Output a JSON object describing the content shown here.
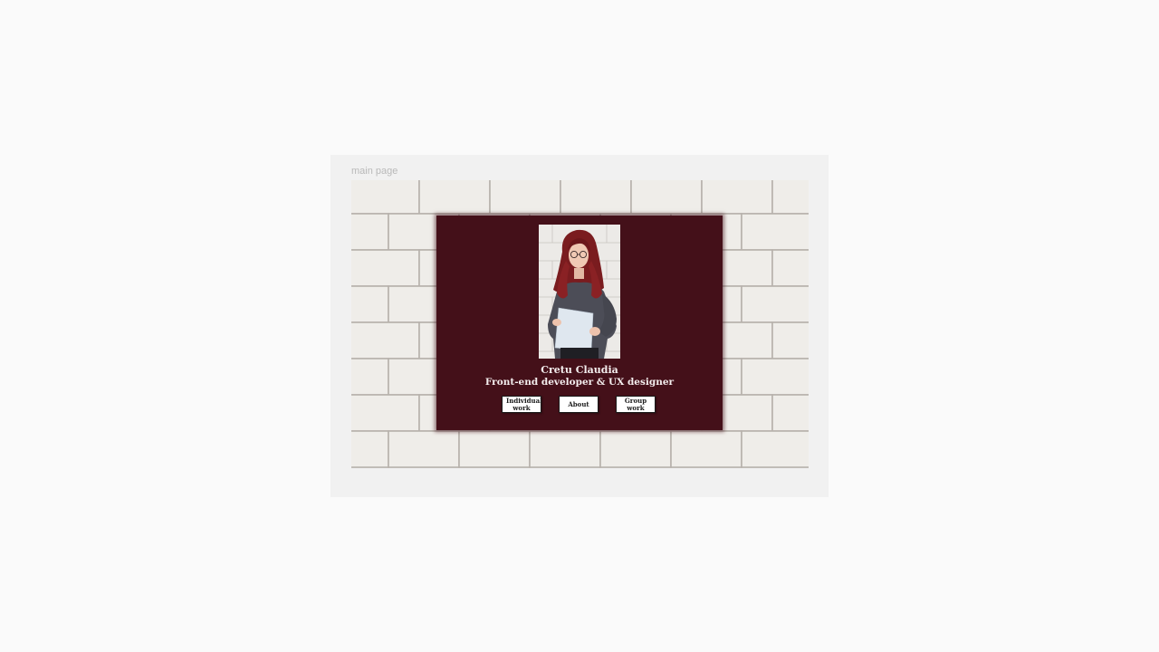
{
  "frame": {
    "label": "main page"
  },
  "profile": {
    "name": "Cretu Claudia",
    "role": "Front-end developer & UX designer",
    "photo_icon": "portrait-photo"
  },
  "nav": {
    "individual_label": "Individual work",
    "about_label": "About",
    "group_label": "Group work"
  },
  "colors": {
    "overlay": "#441019",
    "brick": "#e6e3df",
    "mortar": "#bdb8b2",
    "button_bg": "#ffffff",
    "text_light": "#f4eeee"
  }
}
